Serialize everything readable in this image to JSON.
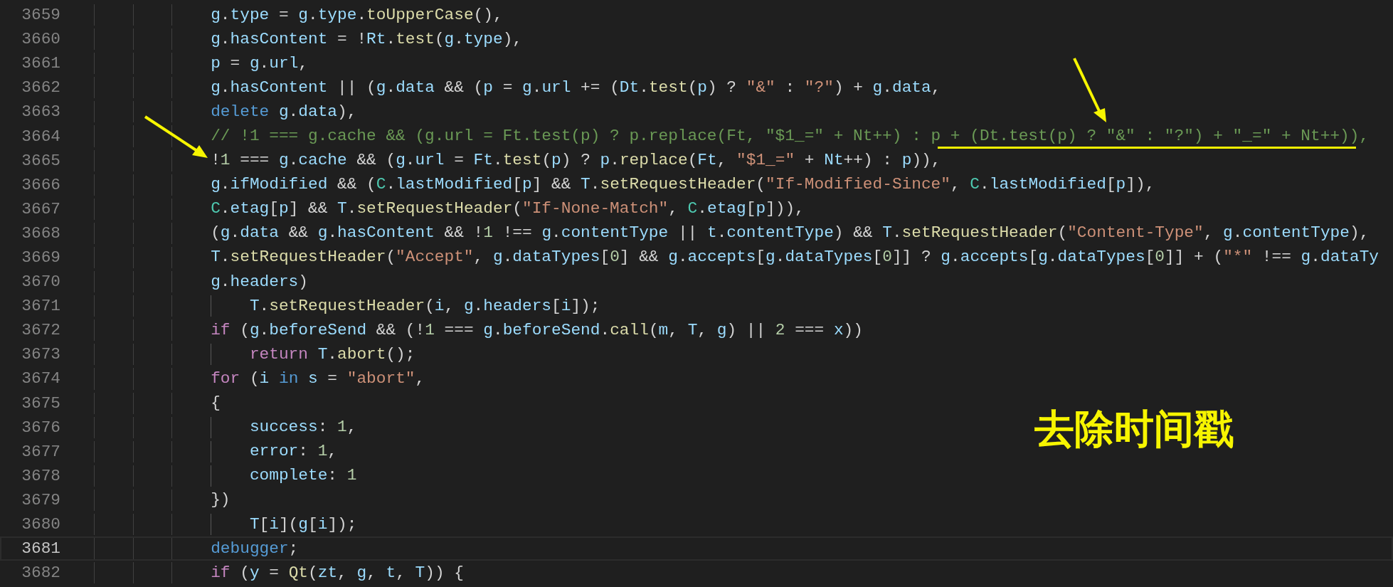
{
  "editor": {
    "lines": [
      {
        "number": "3659",
        "nested": false,
        "current": false,
        "tokens": [
          {
            "kind": "variable",
            "text": "g"
          },
          {
            "kind": "punct",
            "text": "."
          },
          {
            "kind": "variable",
            "text": "type"
          },
          {
            "kind": "punct",
            "text": " = "
          },
          {
            "kind": "variable",
            "text": "g"
          },
          {
            "kind": "punct",
            "text": "."
          },
          {
            "kind": "variable",
            "text": "type"
          },
          {
            "kind": "punct",
            "text": "."
          },
          {
            "kind": "function",
            "text": "toUpperCase"
          },
          {
            "kind": "punct",
            "text": "(),"
          }
        ]
      },
      {
        "number": "3660",
        "nested": false,
        "current": false,
        "tokens": [
          {
            "kind": "variable",
            "text": "g"
          },
          {
            "kind": "punct",
            "text": "."
          },
          {
            "kind": "variable",
            "text": "hasContent"
          },
          {
            "kind": "punct",
            "text": " = !"
          },
          {
            "kind": "variable",
            "text": "Rt"
          },
          {
            "kind": "punct",
            "text": "."
          },
          {
            "kind": "function",
            "text": "test"
          },
          {
            "kind": "punct",
            "text": "("
          },
          {
            "kind": "variable",
            "text": "g"
          },
          {
            "kind": "punct",
            "text": "."
          },
          {
            "kind": "variable",
            "text": "type"
          },
          {
            "kind": "punct",
            "text": "),"
          }
        ]
      },
      {
        "number": "3661",
        "nested": false,
        "current": false,
        "tokens": [
          {
            "kind": "variable",
            "text": "p"
          },
          {
            "kind": "punct",
            "text": " = "
          },
          {
            "kind": "variable",
            "text": "g"
          },
          {
            "kind": "punct",
            "text": "."
          },
          {
            "kind": "variable",
            "text": "url"
          },
          {
            "kind": "punct",
            "text": ","
          }
        ]
      },
      {
        "number": "3662",
        "nested": false,
        "current": false,
        "tokens": [
          {
            "kind": "variable",
            "text": "g"
          },
          {
            "kind": "punct",
            "text": "."
          },
          {
            "kind": "variable",
            "text": "hasContent"
          },
          {
            "kind": "punct",
            "text": " || ("
          },
          {
            "kind": "variable",
            "text": "g"
          },
          {
            "kind": "punct",
            "text": "."
          },
          {
            "kind": "variable",
            "text": "data"
          },
          {
            "kind": "punct",
            "text": " && ("
          },
          {
            "kind": "variable",
            "text": "p"
          },
          {
            "kind": "punct",
            "text": " = "
          },
          {
            "kind": "variable",
            "text": "g"
          },
          {
            "kind": "punct",
            "text": "."
          },
          {
            "kind": "variable",
            "text": "url"
          },
          {
            "kind": "punct",
            "text": " += ("
          },
          {
            "kind": "variable",
            "text": "Dt"
          },
          {
            "kind": "punct",
            "text": "."
          },
          {
            "kind": "function",
            "text": "test"
          },
          {
            "kind": "punct",
            "text": "("
          },
          {
            "kind": "variable",
            "text": "p"
          },
          {
            "kind": "punct",
            "text": ") ? "
          },
          {
            "kind": "string",
            "text": "\"&\""
          },
          {
            "kind": "punct",
            "text": " : "
          },
          {
            "kind": "string",
            "text": "\"?\""
          },
          {
            "kind": "punct",
            "text": ") + "
          },
          {
            "kind": "variable",
            "text": "g"
          },
          {
            "kind": "punct",
            "text": "."
          },
          {
            "kind": "variable",
            "text": "data"
          },
          {
            "kind": "punct",
            "text": ","
          }
        ]
      },
      {
        "number": "3663",
        "nested": false,
        "current": false,
        "tokens": [
          {
            "kind": "keyword",
            "text": "delete "
          },
          {
            "kind": "variable",
            "text": "g"
          },
          {
            "kind": "punct",
            "text": "."
          },
          {
            "kind": "variable",
            "text": "data"
          },
          {
            "kind": "punct",
            "text": "),"
          }
        ]
      },
      {
        "number": "3664",
        "nested": false,
        "current": false,
        "tokens": [
          {
            "kind": "comment",
            "text": "// !1 === g.cache && (g.url = Ft.test(p) ? p.replace(Ft, \"$1_=\" + Nt++) : p + (Dt.test(p) ? \"&\" : \"?\") + \"_=\" + Nt++)),"
          }
        ]
      },
      {
        "number": "3665",
        "nested": false,
        "current": false,
        "tokens": [
          {
            "kind": "punct",
            "text": "!"
          },
          {
            "kind": "number",
            "text": "1"
          },
          {
            "kind": "punct",
            "text": " === "
          },
          {
            "kind": "variable",
            "text": "g"
          },
          {
            "kind": "punct",
            "text": "."
          },
          {
            "kind": "variable",
            "text": "cache"
          },
          {
            "kind": "punct",
            "text": " && ("
          },
          {
            "kind": "variable",
            "text": "g"
          },
          {
            "kind": "punct",
            "text": "."
          },
          {
            "kind": "variable",
            "text": "url"
          },
          {
            "kind": "punct",
            "text": " = "
          },
          {
            "kind": "variable",
            "text": "Ft"
          },
          {
            "kind": "punct",
            "text": "."
          },
          {
            "kind": "function",
            "text": "test"
          },
          {
            "kind": "punct",
            "text": "("
          },
          {
            "kind": "variable",
            "text": "p"
          },
          {
            "kind": "punct",
            "text": ") ? "
          },
          {
            "kind": "variable",
            "text": "p"
          },
          {
            "kind": "punct",
            "text": "."
          },
          {
            "kind": "function",
            "text": "replace"
          },
          {
            "kind": "punct",
            "text": "("
          },
          {
            "kind": "variable",
            "text": "Ft"
          },
          {
            "kind": "punct",
            "text": ", "
          },
          {
            "kind": "string",
            "text": "\"$1_=\""
          },
          {
            "kind": "punct",
            "text": " + "
          },
          {
            "kind": "variable",
            "text": "Nt"
          },
          {
            "kind": "punct",
            "text": "++) : "
          },
          {
            "kind": "variable",
            "text": "p"
          },
          {
            "kind": "punct",
            "text": ")),"
          }
        ]
      },
      {
        "number": "3666",
        "nested": false,
        "current": false,
        "tokens": [
          {
            "kind": "variable",
            "text": "g"
          },
          {
            "kind": "punct",
            "text": "."
          },
          {
            "kind": "variable",
            "text": "ifModified"
          },
          {
            "kind": "punct",
            "text": " && ("
          },
          {
            "kind": "type",
            "text": "C"
          },
          {
            "kind": "punct",
            "text": "."
          },
          {
            "kind": "variable",
            "text": "lastModified"
          },
          {
            "kind": "punct",
            "text": "["
          },
          {
            "kind": "variable",
            "text": "p"
          },
          {
            "kind": "punct",
            "text": "] && "
          },
          {
            "kind": "variable",
            "text": "T"
          },
          {
            "kind": "punct",
            "text": "."
          },
          {
            "kind": "function",
            "text": "setRequestHeader"
          },
          {
            "kind": "punct",
            "text": "("
          },
          {
            "kind": "string",
            "text": "\"If-Modified-Since\""
          },
          {
            "kind": "punct",
            "text": ", "
          },
          {
            "kind": "type",
            "text": "C"
          },
          {
            "kind": "punct",
            "text": "."
          },
          {
            "kind": "variable",
            "text": "lastModified"
          },
          {
            "kind": "punct",
            "text": "["
          },
          {
            "kind": "variable",
            "text": "p"
          },
          {
            "kind": "punct",
            "text": "]),"
          }
        ]
      },
      {
        "number": "3667",
        "nested": false,
        "current": false,
        "tokens": [
          {
            "kind": "type",
            "text": "C"
          },
          {
            "kind": "punct",
            "text": "."
          },
          {
            "kind": "variable",
            "text": "etag"
          },
          {
            "kind": "punct",
            "text": "["
          },
          {
            "kind": "variable",
            "text": "p"
          },
          {
            "kind": "punct",
            "text": "] && "
          },
          {
            "kind": "variable",
            "text": "T"
          },
          {
            "kind": "punct",
            "text": "."
          },
          {
            "kind": "function",
            "text": "setRequestHeader"
          },
          {
            "kind": "punct",
            "text": "("
          },
          {
            "kind": "string",
            "text": "\"If-None-Match\""
          },
          {
            "kind": "punct",
            "text": ", "
          },
          {
            "kind": "type",
            "text": "C"
          },
          {
            "kind": "punct",
            "text": "."
          },
          {
            "kind": "variable",
            "text": "etag"
          },
          {
            "kind": "punct",
            "text": "["
          },
          {
            "kind": "variable",
            "text": "p"
          },
          {
            "kind": "punct",
            "text": "])),"
          }
        ]
      },
      {
        "number": "3668",
        "nested": false,
        "current": false,
        "tokens": [
          {
            "kind": "punct",
            "text": "("
          },
          {
            "kind": "variable",
            "text": "g"
          },
          {
            "kind": "punct",
            "text": "."
          },
          {
            "kind": "variable",
            "text": "data"
          },
          {
            "kind": "punct",
            "text": " && "
          },
          {
            "kind": "variable",
            "text": "g"
          },
          {
            "kind": "punct",
            "text": "."
          },
          {
            "kind": "variable",
            "text": "hasContent"
          },
          {
            "kind": "punct",
            "text": " && !"
          },
          {
            "kind": "number",
            "text": "1"
          },
          {
            "kind": "punct",
            "text": " !== "
          },
          {
            "kind": "variable",
            "text": "g"
          },
          {
            "kind": "punct",
            "text": "."
          },
          {
            "kind": "variable",
            "text": "contentType"
          },
          {
            "kind": "punct",
            "text": " || "
          },
          {
            "kind": "variable",
            "text": "t"
          },
          {
            "kind": "punct",
            "text": "."
          },
          {
            "kind": "variable",
            "text": "contentType"
          },
          {
            "kind": "punct",
            "text": ") && "
          },
          {
            "kind": "variable",
            "text": "T"
          },
          {
            "kind": "punct",
            "text": "."
          },
          {
            "kind": "function",
            "text": "setRequestHeader"
          },
          {
            "kind": "punct",
            "text": "("
          },
          {
            "kind": "string",
            "text": "\"Content-Type\""
          },
          {
            "kind": "punct",
            "text": ", "
          },
          {
            "kind": "variable",
            "text": "g"
          },
          {
            "kind": "punct",
            "text": "."
          },
          {
            "kind": "variable",
            "text": "contentType"
          },
          {
            "kind": "punct",
            "text": "),"
          }
        ]
      },
      {
        "number": "3669",
        "nested": false,
        "current": false,
        "tokens": [
          {
            "kind": "variable",
            "text": "T"
          },
          {
            "kind": "punct",
            "text": "."
          },
          {
            "kind": "function",
            "text": "setRequestHeader"
          },
          {
            "kind": "punct",
            "text": "("
          },
          {
            "kind": "string",
            "text": "\"Accept\""
          },
          {
            "kind": "punct",
            "text": ", "
          },
          {
            "kind": "variable",
            "text": "g"
          },
          {
            "kind": "punct",
            "text": "."
          },
          {
            "kind": "variable",
            "text": "dataTypes"
          },
          {
            "kind": "punct",
            "text": "["
          },
          {
            "kind": "number",
            "text": "0"
          },
          {
            "kind": "punct",
            "text": "] && "
          },
          {
            "kind": "variable",
            "text": "g"
          },
          {
            "kind": "punct",
            "text": "."
          },
          {
            "kind": "variable",
            "text": "accepts"
          },
          {
            "kind": "punct",
            "text": "["
          },
          {
            "kind": "variable",
            "text": "g"
          },
          {
            "kind": "punct",
            "text": "."
          },
          {
            "kind": "variable",
            "text": "dataTypes"
          },
          {
            "kind": "punct",
            "text": "["
          },
          {
            "kind": "number",
            "text": "0"
          },
          {
            "kind": "punct",
            "text": "]] ? "
          },
          {
            "kind": "variable",
            "text": "g"
          },
          {
            "kind": "punct",
            "text": "."
          },
          {
            "kind": "variable",
            "text": "accepts"
          },
          {
            "kind": "punct",
            "text": "["
          },
          {
            "kind": "variable",
            "text": "g"
          },
          {
            "kind": "punct",
            "text": "."
          },
          {
            "kind": "variable",
            "text": "dataTypes"
          },
          {
            "kind": "punct",
            "text": "["
          },
          {
            "kind": "number",
            "text": "0"
          },
          {
            "kind": "punct",
            "text": "]] + ("
          },
          {
            "kind": "string",
            "text": "\"*\""
          },
          {
            "kind": "punct",
            "text": " !== "
          },
          {
            "kind": "variable",
            "text": "g"
          },
          {
            "kind": "punct",
            "text": "."
          },
          {
            "kind": "variable",
            "text": "dataTy"
          }
        ]
      },
      {
        "number": "3670",
        "nested": false,
        "current": false,
        "tokens": [
          {
            "kind": "variable",
            "text": "g"
          },
          {
            "kind": "punct",
            "text": "."
          },
          {
            "kind": "variable",
            "text": "headers"
          },
          {
            "kind": "punct",
            "text": ")"
          }
        ]
      },
      {
        "number": "3671",
        "nested": true,
        "current": false,
        "tokens": [
          {
            "kind": "variable",
            "text": "T"
          },
          {
            "kind": "punct",
            "text": "."
          },
          {
            "kind": "function",
            "text": "setRequestHeader"
          },
          {
            "kind": "punct",
            "text": "("
          },
          {
            "kind": "variable",
            "text": "i"
          },
          {
            "kind": "punct",
            "text": ", "
          },
          {
            "kind": "variable",
            "text": "g"
          },
          {
            "kind": "punct",
            "text": "."
          },
          {
            "kind": "variable",
            "text": "headers"
          },
          {
            "kind": "punct",
            "text": "["
          },
          {
            "kind": "variable",
            "text": "i"
          },
          {
            "kind": "punct",
            "text": "]);"
          }
        ]
      },
      {
        "number": "3672",
        "nested": false,
        "current": false,
        "tokens": [
          {
            "kind": "control",
            "text": "if"
          },
          {
            "kind": "punct",
            "text": " ("
          },
          {
            "kind": "variable",
            "text": "g"
          },
          {
            "kind": "punct",
            "text": "."
          },
          {
            "kind": "variable",
            "text": "beforeSend"
          },
          {
            "kind": "punct",
            "text": " && (!"
          },
          {
            "kind": "number",
            "text": "1"
          },
          {
            "kind": "punct",
            "text": " === "
          },
          {
            "kind": "variable",
            "text": "g"
          },
          {
            "kind": "punct",
            "text": "."
          },
          {
            "kind": "variable",
            "text": "beforeSend"
          },
          {
            "kind": "punct",
            "text": "."
          },
          {
            "kind": "function",
            "text": "call"
          },
          {
            "kind": "punct",
            "text": "("
          },
          {
            "kind": "variable",
            "text": "m"
          },
          {
            "kind": "punct",
            "text": ", "
          },
          {
            "kind": "variable",
            "text": "T"
          },
          {
            "kind": "punct",
            "text": ", "
          },
          {
            "kind": "variable",
            "text": "g"
          },
          {
            "kind": "punct",
            "text": ") || "
          },
          {
            "kind": "number",
            "text": "2"
          },
          {
            "kind": "punct",
            "text": " === "
          },
          {
            "kind": "variable",
            "text": "x"
          },
          {
            "kind": "punct",
            "text": "))"
          }
        ]
      },
      {
        "number": "3673",
        "nested": true,
        "current": false,
        "tokens": [
          {
            "kind": "control",
            "text": "return "
          },
          {
            "kind": "variable",
            "text": "T"
          },
          {
            "kind": "punct",
            "text": "."
          },
          {
            "kind": "function",
            "text": "abort"
          },
          {
            "kind": "punct",
            "text": "();"
          }
        ]
      },
      {
        "number": "3674",
        "nested": false,
        "current": false,
        "tokens": [
          {
            "kind": "control",
            "text": "for"
          },
          {
            "kind": "punct",
            "text": " ("
          },
          {
            "kind": "variable",
            "text": "i "
          },
          {
            "kind": "keyword",
            "text": "in "
          },
          {
            "kind": "variable",
            "text": "s"
          },
          {
            "kind": "punct",
            "text": " = "
          },
          {
            "kind": "string",
            "text": "\"abort\""
          },
          {
            "kind": "punct",
            "text": ","
          }
        ]
      },
      {
        "number": "3675",
        "nested": false,
        "current": false,
        "tokens": [
          {
            "kind": "punct",
            "text": "{"
          }
        ]
      },
      {
        "number": "3676",
        "nested": true,
        "current": false,
        "tokens": [
          {
            "kind": "variable",
            "text": "success"
          },
          {
            "kind": "punct",
            "text": ": "
          },
          {
            "kind": "number",
            "text": "1"
          },
          {
            "kind": "punct",
            "text": ","
          }
        ]
      },
      {
        "number": "3677",
        "nested": true,
        "current": false,
        "tokens": [
          {
            "kind": "variable",
            "text": "error"
          },
          {
            "kind": "punct",
            "text": ": "
          },
          {
            "kind": "number",
            "text": "1"
          },
          {
            "kind": "punct",
            "text": ","
          }
        ]
      },
      {
        "number": "3678",
        "nested": true,
        "current": false,
        "tokens": [
          {
            "kind": "variable",
            "text": "complete"
          },
          {
            "kind": "punct",
            "text": ": "
          },
          {
            "kind": "number",
            "text": "1"
          }
        ]
      },
      {
        "number": "3679",
        "nested": false,
        "current": false,
        "tokens": [
          {
            "kind": "punct",
            "text": "})"
          }
        ]
      },
      {
        "number": "3680",
        "nested": true,
        "current": false,
        "tokens": [
          {
            "kind": "variable",
            "text": "T"
          },
          {
            "kind": "punct",
            "text": "["
          },
          {
            "kind": "variable",
            "text": "i"
          },
          {
            "kind": "punct",
            "text": "]("
          },
          {
            "kind": "variable",
            "text": "g"
          },
          {
            "kind": "punct",
            "text": "["
          },
          {
            "kind": "variable",
            "text": "i"
          },
          {
            "kind": "punct",
            "text": "]);"
          }
        ]
      },
      {
        "number": "3681",
        "nested": false,
        "current": true,
        "tokens": [
          {
            "kind": "keyword",
            "text": "debugger"
          },
          {
            "kind": "punct",
            "text": ";"
          }
        ]
      },
      {
        "number": "3682",
        "nested": false,
        "current": false,
        "tokens": [
          {
            "kind": "control",
            "text": "if"
          },
          {
            "kind": "punct",
            "text": " ("
          },
          {
            "kind": "variable",
            "text": "y"
          },
          {
            "kind": "punct",
            "text": " = "
          },
          {
            "kind": "function",
            "text": "Qt"
          },
          {
            "kind": "punct",
            "text": "("
          },
          {
            "kind": "variable",
            "text": "zt"
          },
          {
            "kind": "punct",
            "text": ", "
          },
          {
            "kind": "variable",
            "text": "g"
          },
          {
            "kind": "punct",
            "text": ", "
          },
          {
            "kind": "variable",
            "text": "t"
          },
          {
            "kind": "punct",
            "text": ", "
          },
          {
            "kind": "variable",
            "text": "T"
          },
          {
            "kind": "punct",
            "text": ")) {"
          }
        ]
      }
    ]
  },
  "annotation": {
    "label": "去除时间戳"
  }
}
